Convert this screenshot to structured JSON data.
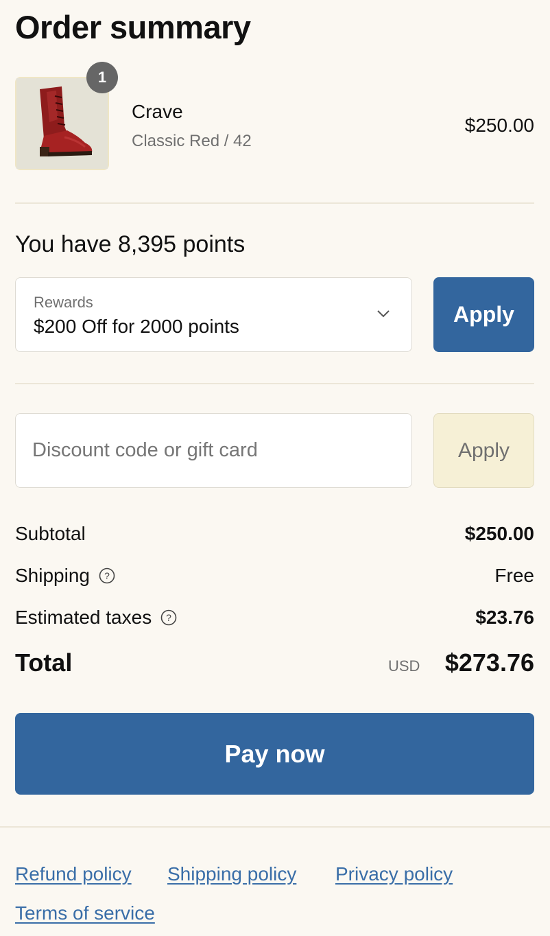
{
  "summary": {
    "title": "Order summary"
  },
  "product": {
    "quantity": "1",
    "name": "Crave",
    "variant": "Classic Red / 42",
    "price": "$250.00",
    "image_icon": "red-lace-up-boot"
  },
  "rewards": {
    "points_text": "You have 8,395 points",
    "select_label": "Rewards",
    "select_value": "$200 Off for 2000 points",
    "apply_label": "Apply"
  },
  "discount": {
    "placeholder": "Discount code or gift card",
    "value": "",
    "apply_label": "Apply"
  },
  "totals": {
    "subtotal_label": "Subtotal",
    "subtotal_value": "$250.00",
    "shipping_label": "Shipping",
    "shipping_value": "Free",
    "taxes_label": "Estimated taxes",
    "taxes_value": "$23.76",
    "total_label": "Total",
    "currency": "USD",
    "total_value": "$273.76"
  },
  "pay_button_label": "Pay now",
  "footer": {
    "refund": "Refund policy",
    "shipping": "Shipping policy",
    "privacy": "Privacy policy",
    "terms": "Terms of service"
  },
  "colors": {
    "background": "#fbf8f2",
    "primary_button": "#33669e",
    "secondary_button": "#f6f0d6",
    "link": "#3a6ea8"
  }
}
